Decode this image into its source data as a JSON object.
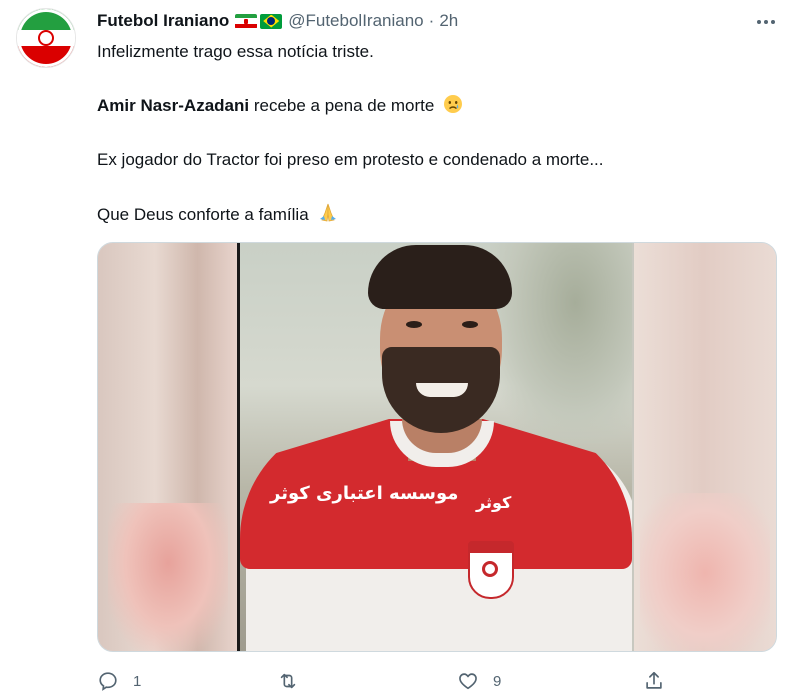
{
  "author": {
    "display_name": "Futebol Iraniano",
    "handle": "@FutebolIraniano",
    "separator": "·",
    "time": "2h",
    "flags": [
      "iran-flag",
      "brazil-flag"
    ]
  },
  "tweet": {
    "line1": "Infelizmente trago essa notícia triste.",
    "line2_bold": "Amir Nasr-Azadani",
    "line2_rest": " recebe a pena de morte",
    "line2_emoji": "crying-face-emoji",
    "line3": "Ex jogador do Tractor foi preso em protesto e condenado a morte...",
    "line4": "Que Deus conforte a família",
    "line4_emoji": "folded-hands-emoji"
  },
  "media": {
    "sponsor_text_left": "موسسه اعتباری کوثر",
    "sponsor_text_right": "کوثر",
    "colors": {
      "jersey_red": "#d32a2e",
      "jersey_white": "#f1eeeb"
    }
  },
  "actions": {
    "reply_count": "1",
    "retweet_count": "",
    "like_count": "9",
    "share_label": ""
  },
  "colors": {
    "text": "#0f1419",
    "secondary": "#536471",
    "border": "#cfd9de"
  }
}
